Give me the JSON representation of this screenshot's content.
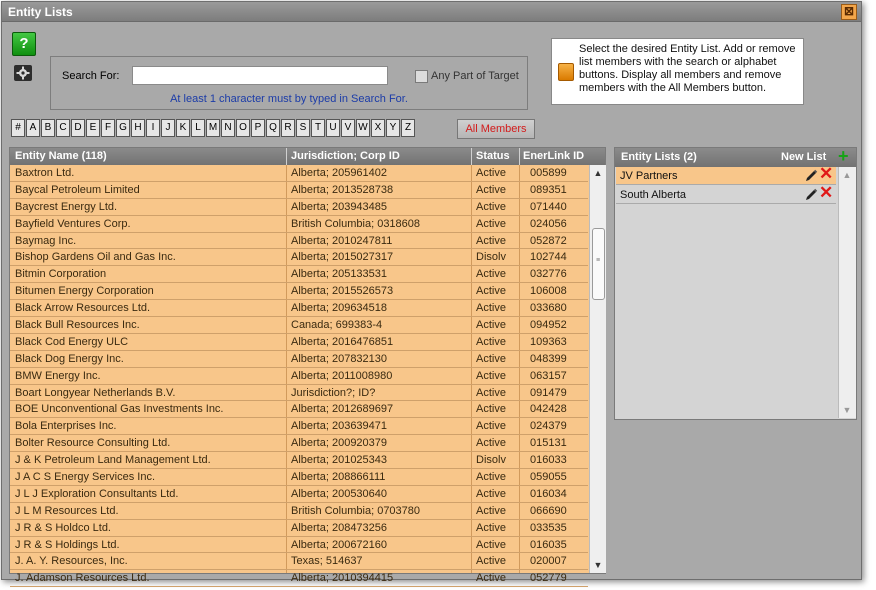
{
  "window": {
    "title": "Entity Lists",
    "close_glyph": "⊠"
  },
  "toolbar": {
    "help_label": "?",
    "help_icon": "help-icon",
    "gear_icon": "gear-icon"
  },
  "search": {
    "label": "Search For:",
    "value": "",
    "placeholder": "",
    "any_part_label": "Any Part of Target",
    "any_part_checked": false,
    "hint": "At least 1 character must by typed in Search For."
  },
  "info": {
    "text": "Select the desired Entity List. Add or remove list members with the search or alphabet buttons. Display all members and remove members with the All Members button."
  },
  "alphabet": [
    "#",
    "A",
    "B",
    "C",
    "D",
    "E",
    "F",
    "G",
    "H",
    "I",
    "J",
    "K",
    "L",
    "M",
    "N",
    "O",
    "P",
    "Q",
    "R",
    "S",
    "T",
    "U",
    "V",
    "W",
    "X",
    "Y",
    "Z"
  ],
  "all_members_label": "All Members",
  "grid": {
    "columns": [
      "Entity Name (118)",
      "Jurisdiction; Corp ID",
      "Status",
      "EnerLink ID"
    ],
    "rows": [
      [
        "Baxtron Ltd.",
        "Alberta; 205961402",
        "Active",
        "005899"
      ],
      [
        "Baycal Petroleum Limited",
        "Alberta; 2013528738",
        "Active",
        "089351"
      ],
      [
        "Baycrest Energy Ltd.",
        "Alberta; 203943485",
        "Active",
        "071440"
      ],
      [
        "Bayfield Ventures Corp.",
        "British Columbia; 0318608",
        "Active",
        "024056"
      ],
      [
        "Baymag Inc.",
        "Alberta; 2010247811",
        "Active",
        "052872"
      ],
      [
        "Bishop Gardens Oil and Gas Inc.",
        "Alberta; 2015027317",
        "Disolv",
        "102744"
      ],
      [
        "Bitmin Corporation",
        "Alberta; 205133531",
        "Active",
        "032776"
      ],
      [
        "Bitumen Energy Corporation",
        "Alberta; 2015526573",
        "Active",
        "106008"
      ],
      [
        "Black Arrow Resources Ltd.",
        "Alberta; 209634518",
        "Active",
        "033680"
      ],
      [
        "Black Bull Resources Inc.",
        "Canada; 699383-4",
        "Active",
        "094952"
      ],
      [
        "Black Cod Energy ULC",
        "Alberta; 2016476851",
        "Active",
        "109363"
      ],
      [
        "Black Dog Energy Inc.",
        "Alberta; 207832130",
        "Active",
        "048399"
      ],
      [
        "BMW Energy Inc.",
        "Alberta; 2011008980",
        "Active",
        "063157"
      ],
      [
        "Boart Longyear Netherlands B.V.",
        "Jurisdiction?; ID?",
        "Active",
        "091479"
      ],
      [
        "BOE Unconventional Gas Investments Inc.",
        "Alberta; 2012689697",
        "Active",
        "042428"
      ],
      [
        "Bola Enterprises Inc.",
        "Alberta; 203639471",
        "Active",
        "024379"
      ],
      [
        "Bolter Resource Consulting Ltd.",
        "Alberta; 200920379",
        "Active",
        "015131"
      ],
      [
        "J & K Petroleum Land Management Ltd.",
        "Alberta; 201025343",
        "Disolv",
        "016033"
      ],
      [
        "J A C S Energy Services Inc.",
        "Alberta; 208866111",
        "Active",
        "059055"
      ],
      [
        "J L J Exploration Consultants Ltd.",
        "Alberta; 200530640",
        "Active",
        "016034"
      ],
      [
        "J L M Resources Ltd.",
        "British Columbia; 0703780",
        "Active",
        "066690"
      ],
      [
        "J R & S Holdco Ltd.",
        "Alberta; 208473256",
        "Active",
        "033535"
      ],
      [
        "J R & S Holdings Ltd.",
        "Alberta; 200672160",
        "Active",
        "016035"
      ],
      [
        "J. A. Y. Resources, Inc.",
        "Texas; 514637",
        "Active",
        "020007"
      ],
      [
        "J. Adamson Resources Ltd.",
        "Alberta; 2010394415",
        "Active",
        "052779"
      ]
    ],
    "scroll_up": "▲",
    "scroll_down": "▼"
  },
  "entity_lists": {
    "title": "Entity Lists (2)",
    "new_list_label": "New List",
    "items": [
      {
        "name": "JV Partners",
        "selected": true
      },
      {
        "name": "South Alberta",
        "selected": false
      }
    ],
    "scroll_up": "▲",
    "scroll_down": "▼"
  },
  "colors": {
    "window_bg": "#a9a9a9",
    "header_bg": "#7d7d7d",
    "row_bg": "#f8c68a",
    "link_blue": "#1c3ca8",
    "all_members_red": "#d31c1c",
    "add_green": "#16a316",
    "delete_red": "#e01818"
  }
}
